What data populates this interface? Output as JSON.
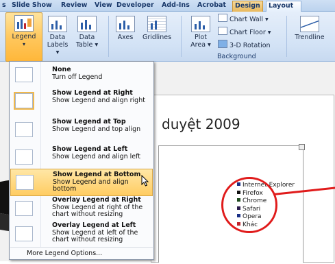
{
  "ribbon": {
    "tabs": [
      "s",
      "Slide Show",
      "Review",
      "View",
      "Developer",
      "Add-Ins",
      "Acrobat",
      "Design",
      "Layout"
    ],
    "buttons": {
      "legend": "Legend",
      "data_labels": "Data\nLabels",
      "data_labels_line1": "Data",
      "data_labels_line2": "Labels ▾",
      "data_table_line1": "Data",
      "data_table_line2": "Table ▾",
      "axes": "Axes",
      "gridlines": "Gridlines",
      "plot_area_line1": "Plot",
      "plot_area_line2": "Area ▾",
      "chart_wall": "Chart Wall ▾",
      "chart_floor": "Chart Floor ▾",
      "rotation": "3-D Rotation",
      "trendline": "Trendline"
    },
    "group_labels": {
      "background": "Background"
    }
  },
  "legend_menu": {
    "items": [
      {
        "title": "None",
        "desc": "Turn off Legend"
      },
      {
        "title": "Show Legend at Right",
        "desc": "Show Legend and align right"
      },
      {
        "title": "Show Legend at Top",
        "desc": "Show Legend and top align"
      },
      {
        "title": "Show Legend at Left",
        "desc": "Show Legend and align left"
      },
      {
        "title": "Show Legend at Bottom",
        "desc": "Show Legend and align bottom"
      },
      {
        "title": "Overlay Legend at Right",
        "desc": "Show Legend at right of the chart without resizing"
      },
      {
        "title": "Overlay Legend at Left",
        "desc": "Show Legend at left of the chart without resizing"
      }
    ],
    "more": "More Legend Options..."
  },
  "slide": {
    "title": "duyệt 2009",
    "legend": [
      {
        "label": "Internet Explorer",
        "color": "#1a2f86"
      },
      {
        "label": "Firefox",
        "color": "#111111"
      },
      {
        "label": "Chrome",
        "color": "#1e4a1e"
      },
      {
        "label": "Safari",
        "color": "#2a1a4a"
      },
      {
        "label": "Opera",
        "color": "#1a2f86"
      },
      {
        "label": "Khác",
        "color": "#c0242d"
      }
    ]
  },
  "colors": {
    "highlight": "#ffcc62",
    "annotation": "#e01b1b"
  }
}
